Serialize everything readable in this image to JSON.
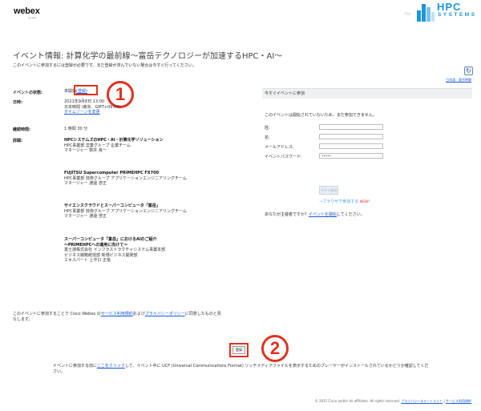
{
  "header": {
    "logo": "webex",
    "logo_sub": "by cisco",
    "partner_for": "For",
    "partner_word": "HPC",
    "partner_sub": "SYSTEMS"
  },
  "event": {
    "title": "イベント情報: 計算化学の最前線〜富岳テクノロジーが加速するHPC・AI〜",
    "subtitle": "このイベントに参加するには登録が必要です。まだ登録が済んでいない場合は今すぐ行ってください。",
    "lang_link": "日本語 : 東京時間",
    "refresh_icon": "↻"
  },
  "details": {
    "status_label": "イベントの状態:",
    "status_value": "未開始",
    "status_link": "(登録)",
    "date_label": "日時:",
    "date_lines": [
      "2021年9月8日 13:00",
      "日本時間 (東京、GMT+09:00)"
    ],
    "timezone_link": "タイムゾーンを変更",
    "duration_label": "継続時間:",
    "duration_value": "1 時間 30 分",
    "detail_label": "詳細:",
    "sessions": [
      {
        "title": "HPCシステムズのHPC・AI・計算化学ソリューション",
        "lines": [
          "HPC事業部 営業グループ 企業チーム",
          "マネージャー 数井 良一"
        ]
      },
      {
        "title": "FUJITSU Supercomputer PRIMEHPC FX700",
        "lines": [
          "HPC事業部 技術グループ アプリケーションエンジニアリングチーム",
          "マネージャー 渡邊 啓正"
        ]
      },
      {
        "title": "サイエンスクラウドとスーパーコンピュータ「富岳」",
        "lines": [
          "HPC事業部 技術グループ アプリケーションエンジニアリングチーム",
          "マネージャー 渡邊 啓正"
        ]
      },
      {
        "title": "スーパーコンピュータ「富岳」におけるAIのご紹介",
        "title2": "〜PRIMEHPCへの適用に向けて〜",
        "lines": [
          "富士通株式会社 インフラストラクチャシステム事業本部",
          "ビジネス戦略統括部 新規ビジネス開発部",
          "エキスパート 上平口 正裕"
        ]
      }
    ]
  },
  "join_panel": {
    "header": "今すぐイベントに参加",
    "not_started": "このイベントは開始されていないため、まだ参加できません。",
    "fields": [
      {
        "label": "姓:",
        "value": ""
      },
      {
        "label": "名:",
        "value": ""
      },
      {
        "label": "メールアドレス:",
        "value": ""
      },
      {
        "label": "イベントパスワード:",
        "value": "•••••"
      }
    ],
    "join_button": "今すぐ参加",
    "browser_join": "ブラウザで参加する",
    "new_badge": "NEW!",
    "host_prefix": "あなたが主催者ですか？",
    "host_link": "イベントを開始",
    "host_suffix": "してください。"
  },
  "terms": {
    "prefix": "このイベントに参加することで Cisco Webex の",
    "tos_link": "サービス利用規約",
    "middle": "および",
    "privacy_link": "プライバシーポリシー",
    "suffix": "に同意したものと見なします。"
  },
  "register_button": "登録",
  "annotations": {
    "one": "1",
    "two": "2"
  },
  "bottom_note": {
    "prefix": "イベントに参加する前に",
    "link": "ここをクリック",
    "suffix": "して、イベント中に UCF (Universal Communications Format) リッチメディアファイルを表示するためのプレーヤーがインストールされているかどうか確認してください。"
  },
  "footer": {
    "copyright": "© 2021 Cisco and/or its affiliates. All rights reserved.",
    "privacy": "プライバシーステートメント",
    "sep": " | ",
    "tos": "サービス利用規約"
  },
  "colors": {
    "accent_red": "#e0321f",
    "link_blue": "#1a5ad6",
    "hpc_blue": "#1a97d8"
  }
}
